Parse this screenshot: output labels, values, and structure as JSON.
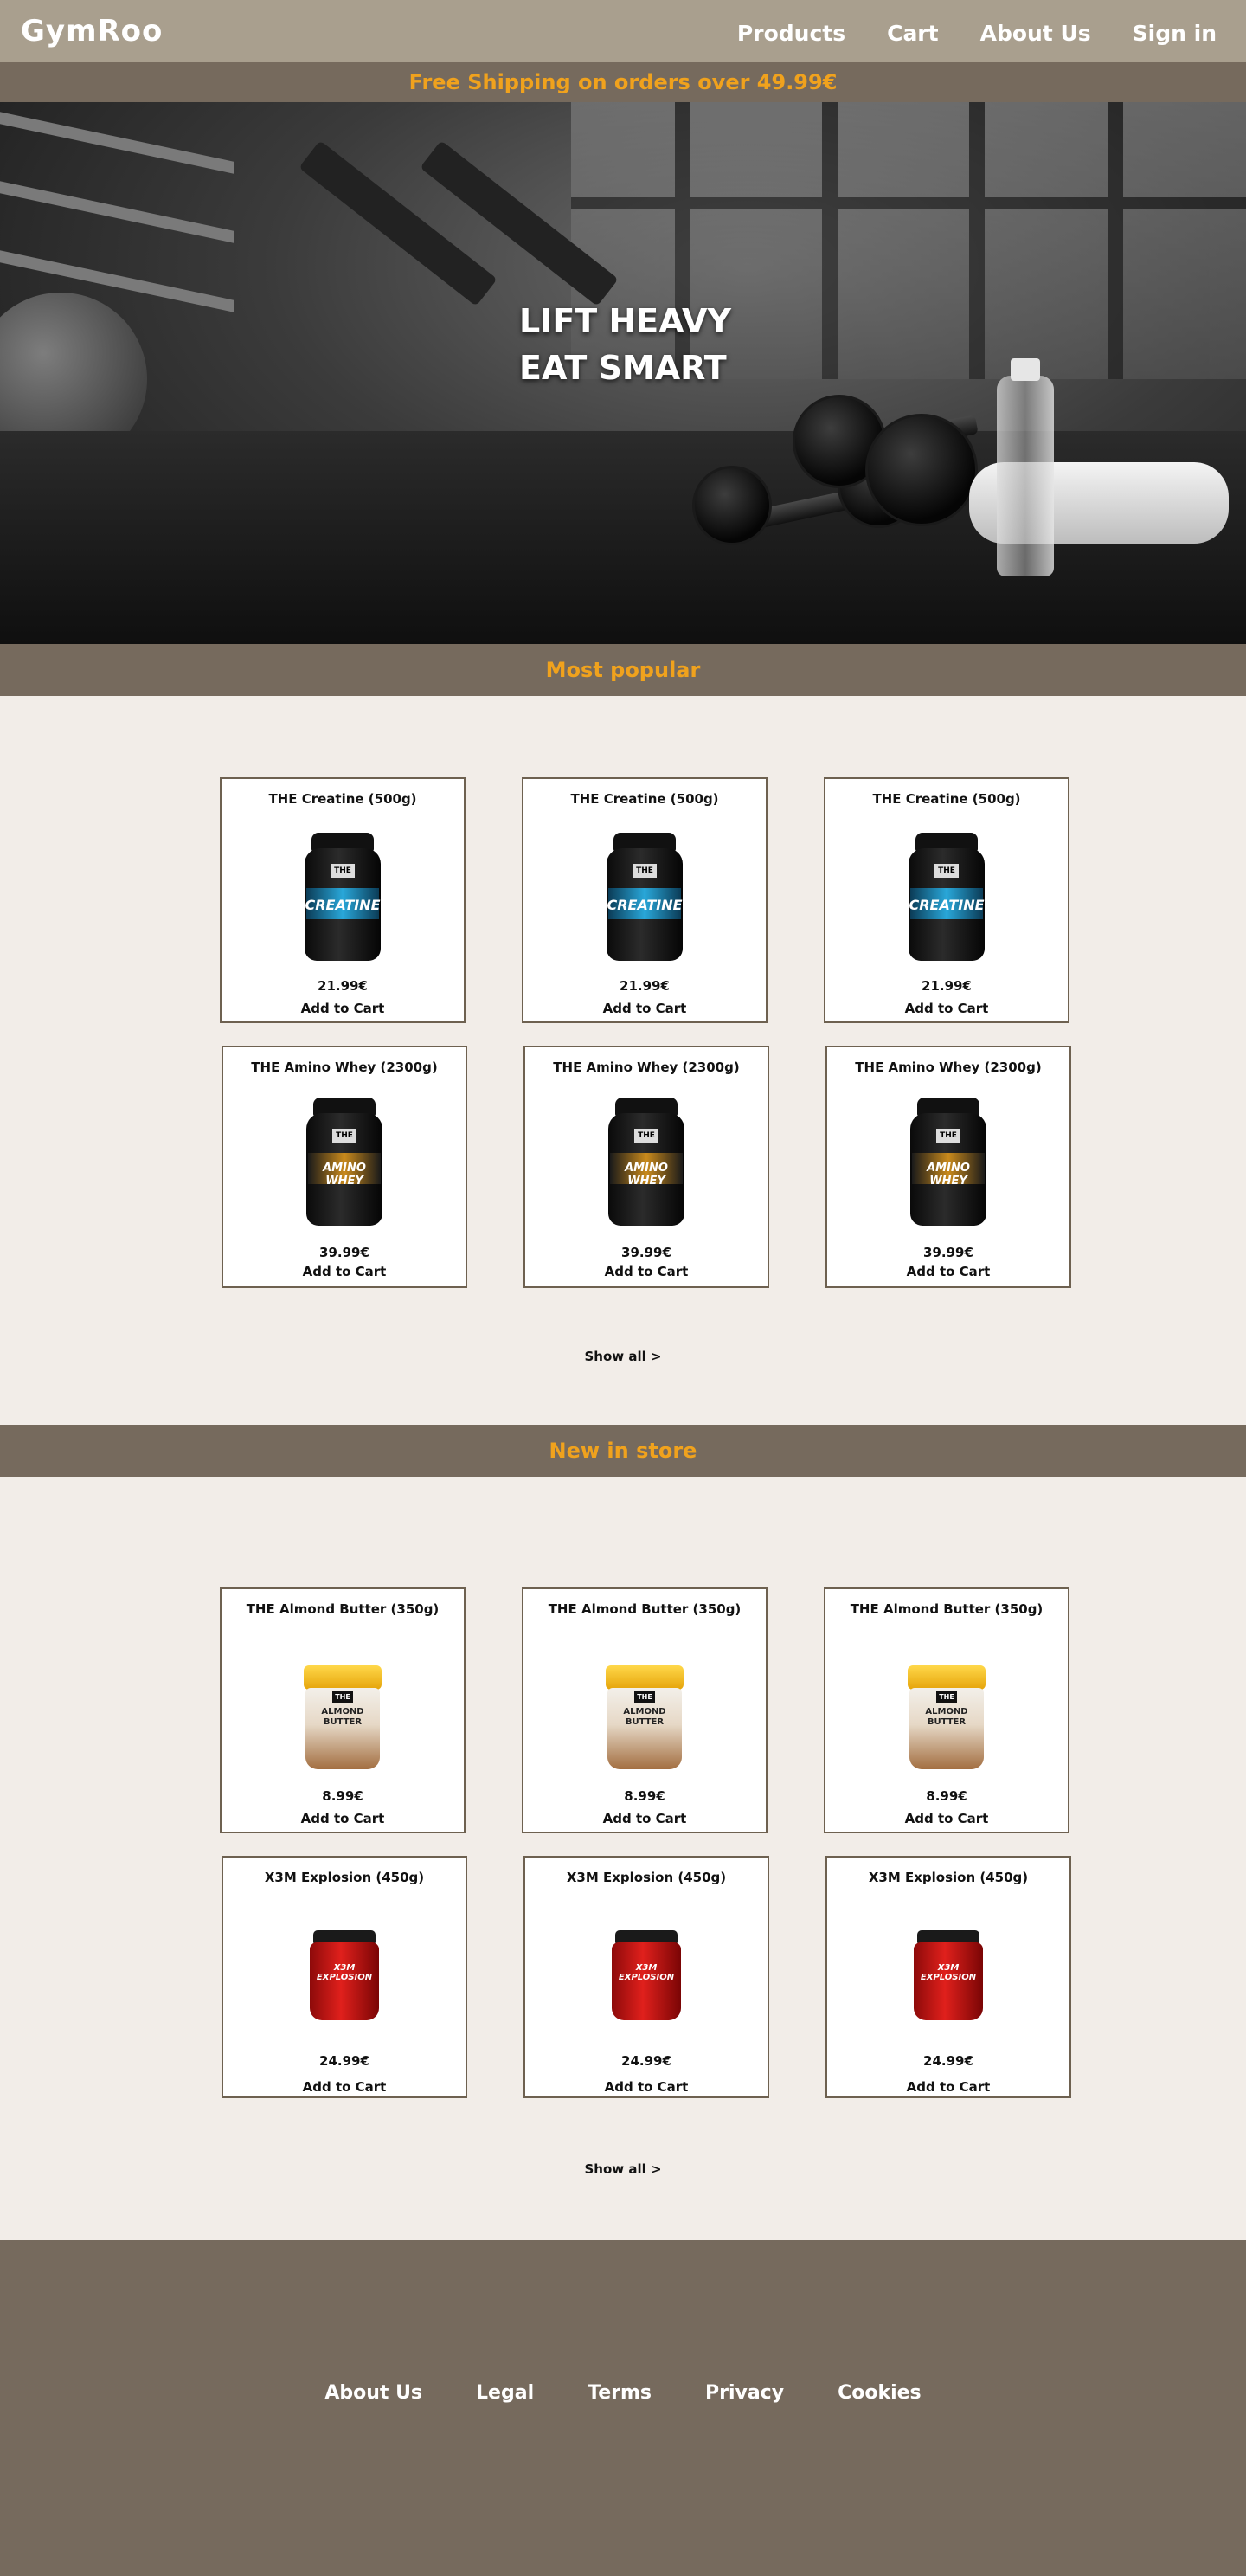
{
  "header": {
    "logo": "GymRoo",
    "nav": [
      "Products",
      "Cart",
      "About Us",
      "Sign in"
    ]
  },
  "promo": "Free Shipping on orders over 49.99€",
  "hero": {
    "line1": "LIFT HEAVY",
    "line2": "EAT SMART"
  },
  "popular": {
    "title": "Most popular",
    "products": [
      {
        "name": "THE Creatine (500g)",
        "price": "21.99€",
        "cta": "Add to Cart",
        "label": "CREATINE"
      },
      {
        "name": "THE Creatine (500g)",
        "price": "21.99€",
        "cta": "Add to Cart",
        "label": "CREATINE"
      },
      {
        "name": "THE Creatine (500g)",
        "price": "21.99€",
        "cta": "Add to Cart",
        "label": "CREATINE"
      },
      {
        "name": "THE Amino Whey (2300g)",
        "price": "39.99€",
        "cta": "Add to Cart",
        "label": "AMINO WHEY"
      },
      {
        "name": "THE Amino Whey (2300g)",
        "price": "39.99€",
        "cta": "Add to Cart",
        "label": "AMINO WHEY"
      },
      {
        "name": "THE Amino Whey (2300g)",
        "price": "39.99€",
        "cta": "Add to Cart",
        "label": "AMINO WHEY"
      }
    ],
    "show_all": "Show all >"
  },
  "new_in": {
    "title": "New in store",
    "products": [
      {
        "name": "THE Almond Butter (350g)",
        "price": "8.99€",
        "cta": "Add to Cart",
        "label": "ALMOND BUTTER"
      },
      {
        "name": "THE Almond Butter (350g)",
        "price": "8.99€",
        "cta": "Add to Cart",
        "label": "ALMOND BUTTER"
      },
      {
        "name": "THE Almond Butter (350g)",
        "price": "8.99€",
        "cta": "Add to Cart",
        "label": "ALMOND BUTTER"
      },
      {
        "name": "X3M Explosion (450g)",
        "price": "24.99€",
        "cta": "Add to Cart",
        "label": "X3M EXPLOSION"
      },
      {
        "name": "X3M Explosion (450g)",
        "price": "24.99€",
        "cta": "Add to Cart",
        "label": "X3M EXPLOSION"
      },
      {
        "name": "X3M Explosion (450g)",
        "price": "24.99€",
        "cta": "Add to Cart",
        "label": "X3M EXPLOSION"
      }
    ],
    "show_all": "Show all >"
  },
  "footer": {
    "links": [
      "About Us",
      "Legal",
      "Terms",
      "Privacy",
      "Cookies"
    ]
  },
  "colors": {
    "accent": "#f0a21d",
    "bar": "#766a5d",
    "topbar": "#a99f8e",
    "page_bg": "#f2ede8"
  },
  "badge_text": "THE"
}
